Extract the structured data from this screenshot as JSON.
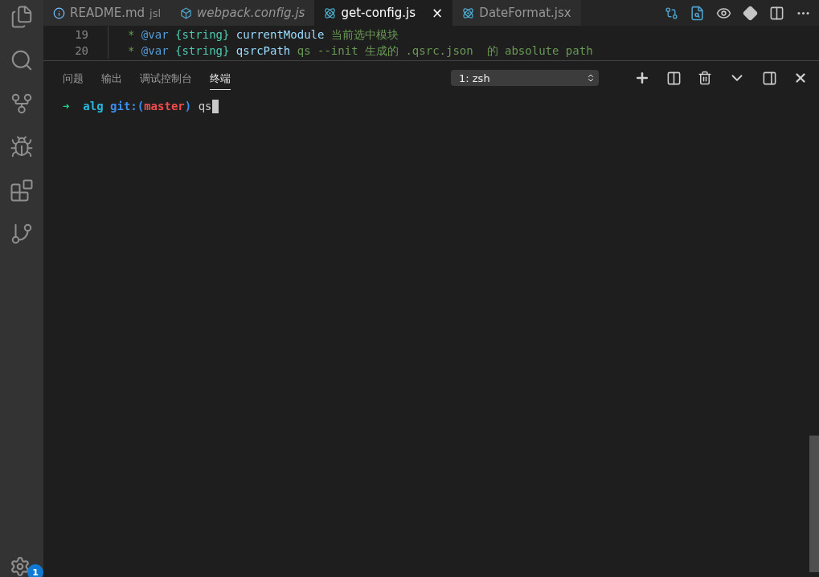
{
  "activity_bar": {
    "items": [
      {
        "kind": "files",
        "selected": false
      },
      {
        "kind": "search",
        "selected": false
      },
      {
        "kind": "scm",
        "selected": false
      },
      {
        "kind": "debug",
        "selected": false
      },
      {
        "kind": "extensions",
        "selected": false
      },
      {
        "kind": "timeline",
        "selected": false
      }
    ],
    "settings_badge": "1"
  },
  "editor_tabs": [
    {
      "label": "README.md",
      "description": "jsl",
      "kind": "info",
      "italic": false,
      "selected": false,
      "closable": false
    },
    {
      "label": "webpack.config.js",
      "kind": "cube",
      "italic": true,
      "selected": false,
      "closable": false
    },
    {
      "label": "get-config.js",
      "kind": "react",
      "italic": false,
      "selected": true,
      "closable": true,
      "close": "×"
    },
    {
      "label": "DateFormat.jsx",
      "kind": "react",
      "italic": false,
      "selected": false,
      "closable": false
    }
  ],
  "code_lines": [
    {
      "number": "19",
      "tokens": [
        {
          "kind": "comment",
          "text": "* "
        },
        {
          "kind": "tag",
          "text": "@var"
        },
        {
          "kind": "type",
          "text": " {string}"
        },
        {
          "kind": "name",
          "text": " currentModule"
        },
        {
          "kind": "comment",
          "text": " 当前选中模块"
        }
      ]
    },
    {
      "number": "20",
      "tokens": [
        {
          "kind": "comment",
          "text": "* "
        },
        {
          "kind": "tag",
          "text": "@var"
        },
        {
          "kind": "type",
          "text": " {string}"
        },
        {
          "kind": "name",
          "text": " qsrcPath"
        },
        {
          "kind": "comment",
          "text": " qs --init 生成的 .qsrc.json  的 absolute path"
        }
      ]
    }
  ],
  "panel": {
    "tabs": [
      {
        "label": "问题",
        "selected": false
      },
      {
        "label": "输出",
        "selected": false
      },
      {
        "label": "调试控制台",
        "selected": false
      },
      {
        "label": "终端",
        "selected": true
      }
    ],
    "terminal_select": "1: zsh",
    "terminal": {
      "arrow": "➜",
      "directory": "alg",
      "git_prefix": "git:(",
      "branch": "master",
      "git_suffix": ")",
      "command": "qs"
    }
  }
}
